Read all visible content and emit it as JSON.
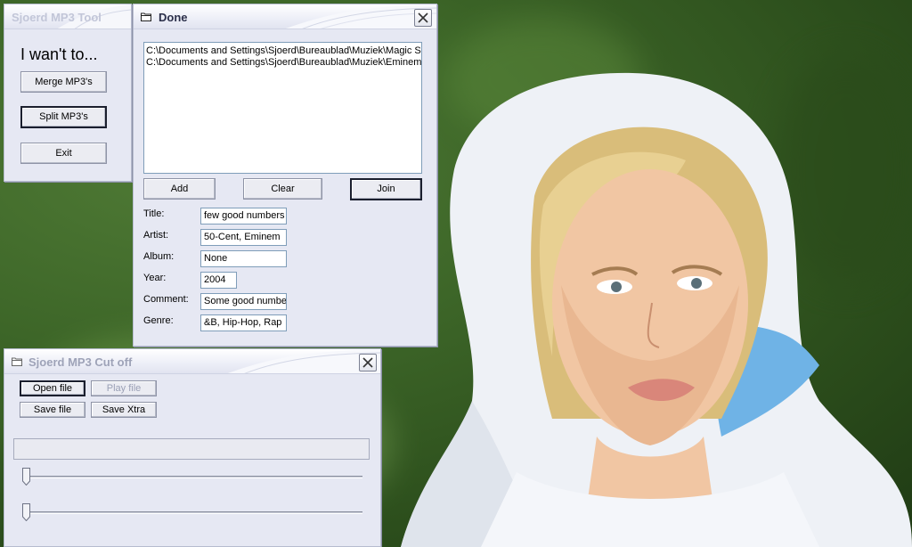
{
  "tool_window": {
    "title": "Sjoerd MP3 Tool",
    "heading": "I wan't to...",
    "merge_label": "Merge MP3's",
    "split_label": "Split MP3's",
    "exit_label": "Exit"
  },
  "join_window": {
    "title": "Done",
    "files": [
      "C:\\Documents and Settings\\Sjoerd\\Bureaublad\\Muziek\\Magic S",
      "C:\\Documents and Settings\\Sjoerd\\Bureaublad\\Muziek\\Eminem"
    ],
    "add_label": "Add",
    "clear_label": "Clear",
    "join_label": "Join",
    "tags": {
      "title_label": "Title:",
      "title_value": "few good numbers",
      "artist_label": "Artist:",
      "artist_value": "50-Cent, Eminem",
      "album_label": "Album:",
      "album_value": "None",
      "year_label": "Year:",
      "year_value": "2004",
      "comment_label": "Comment:",
      "comment_value": "Some good numbe",
      "genre_label": "Genre:",
      "genre_value": "&B, Hip-Hop, Rap"
    }
  },
  "cutoff_window": {
    "title": "Sjoerd MP3 Cut off",
    "open_label": "Open file",
    "play_label": "Play file",
    "save_label": "Save file",
    "save_xtra_label": "Save Xtra",
    "slider_start": 0,
    "slider_end": 0,
    "progress": 0
  },
  "colors": {
    "window_bg": "#e6e8f3",
    "title_active": "#2b2f4a",
    "title_inactive": "#c2c6d8",
    "desktop": "#3d6628"
  },
  "icons": {
    "close": "close-icon",
    "app": "folder-icon"
  }
}
